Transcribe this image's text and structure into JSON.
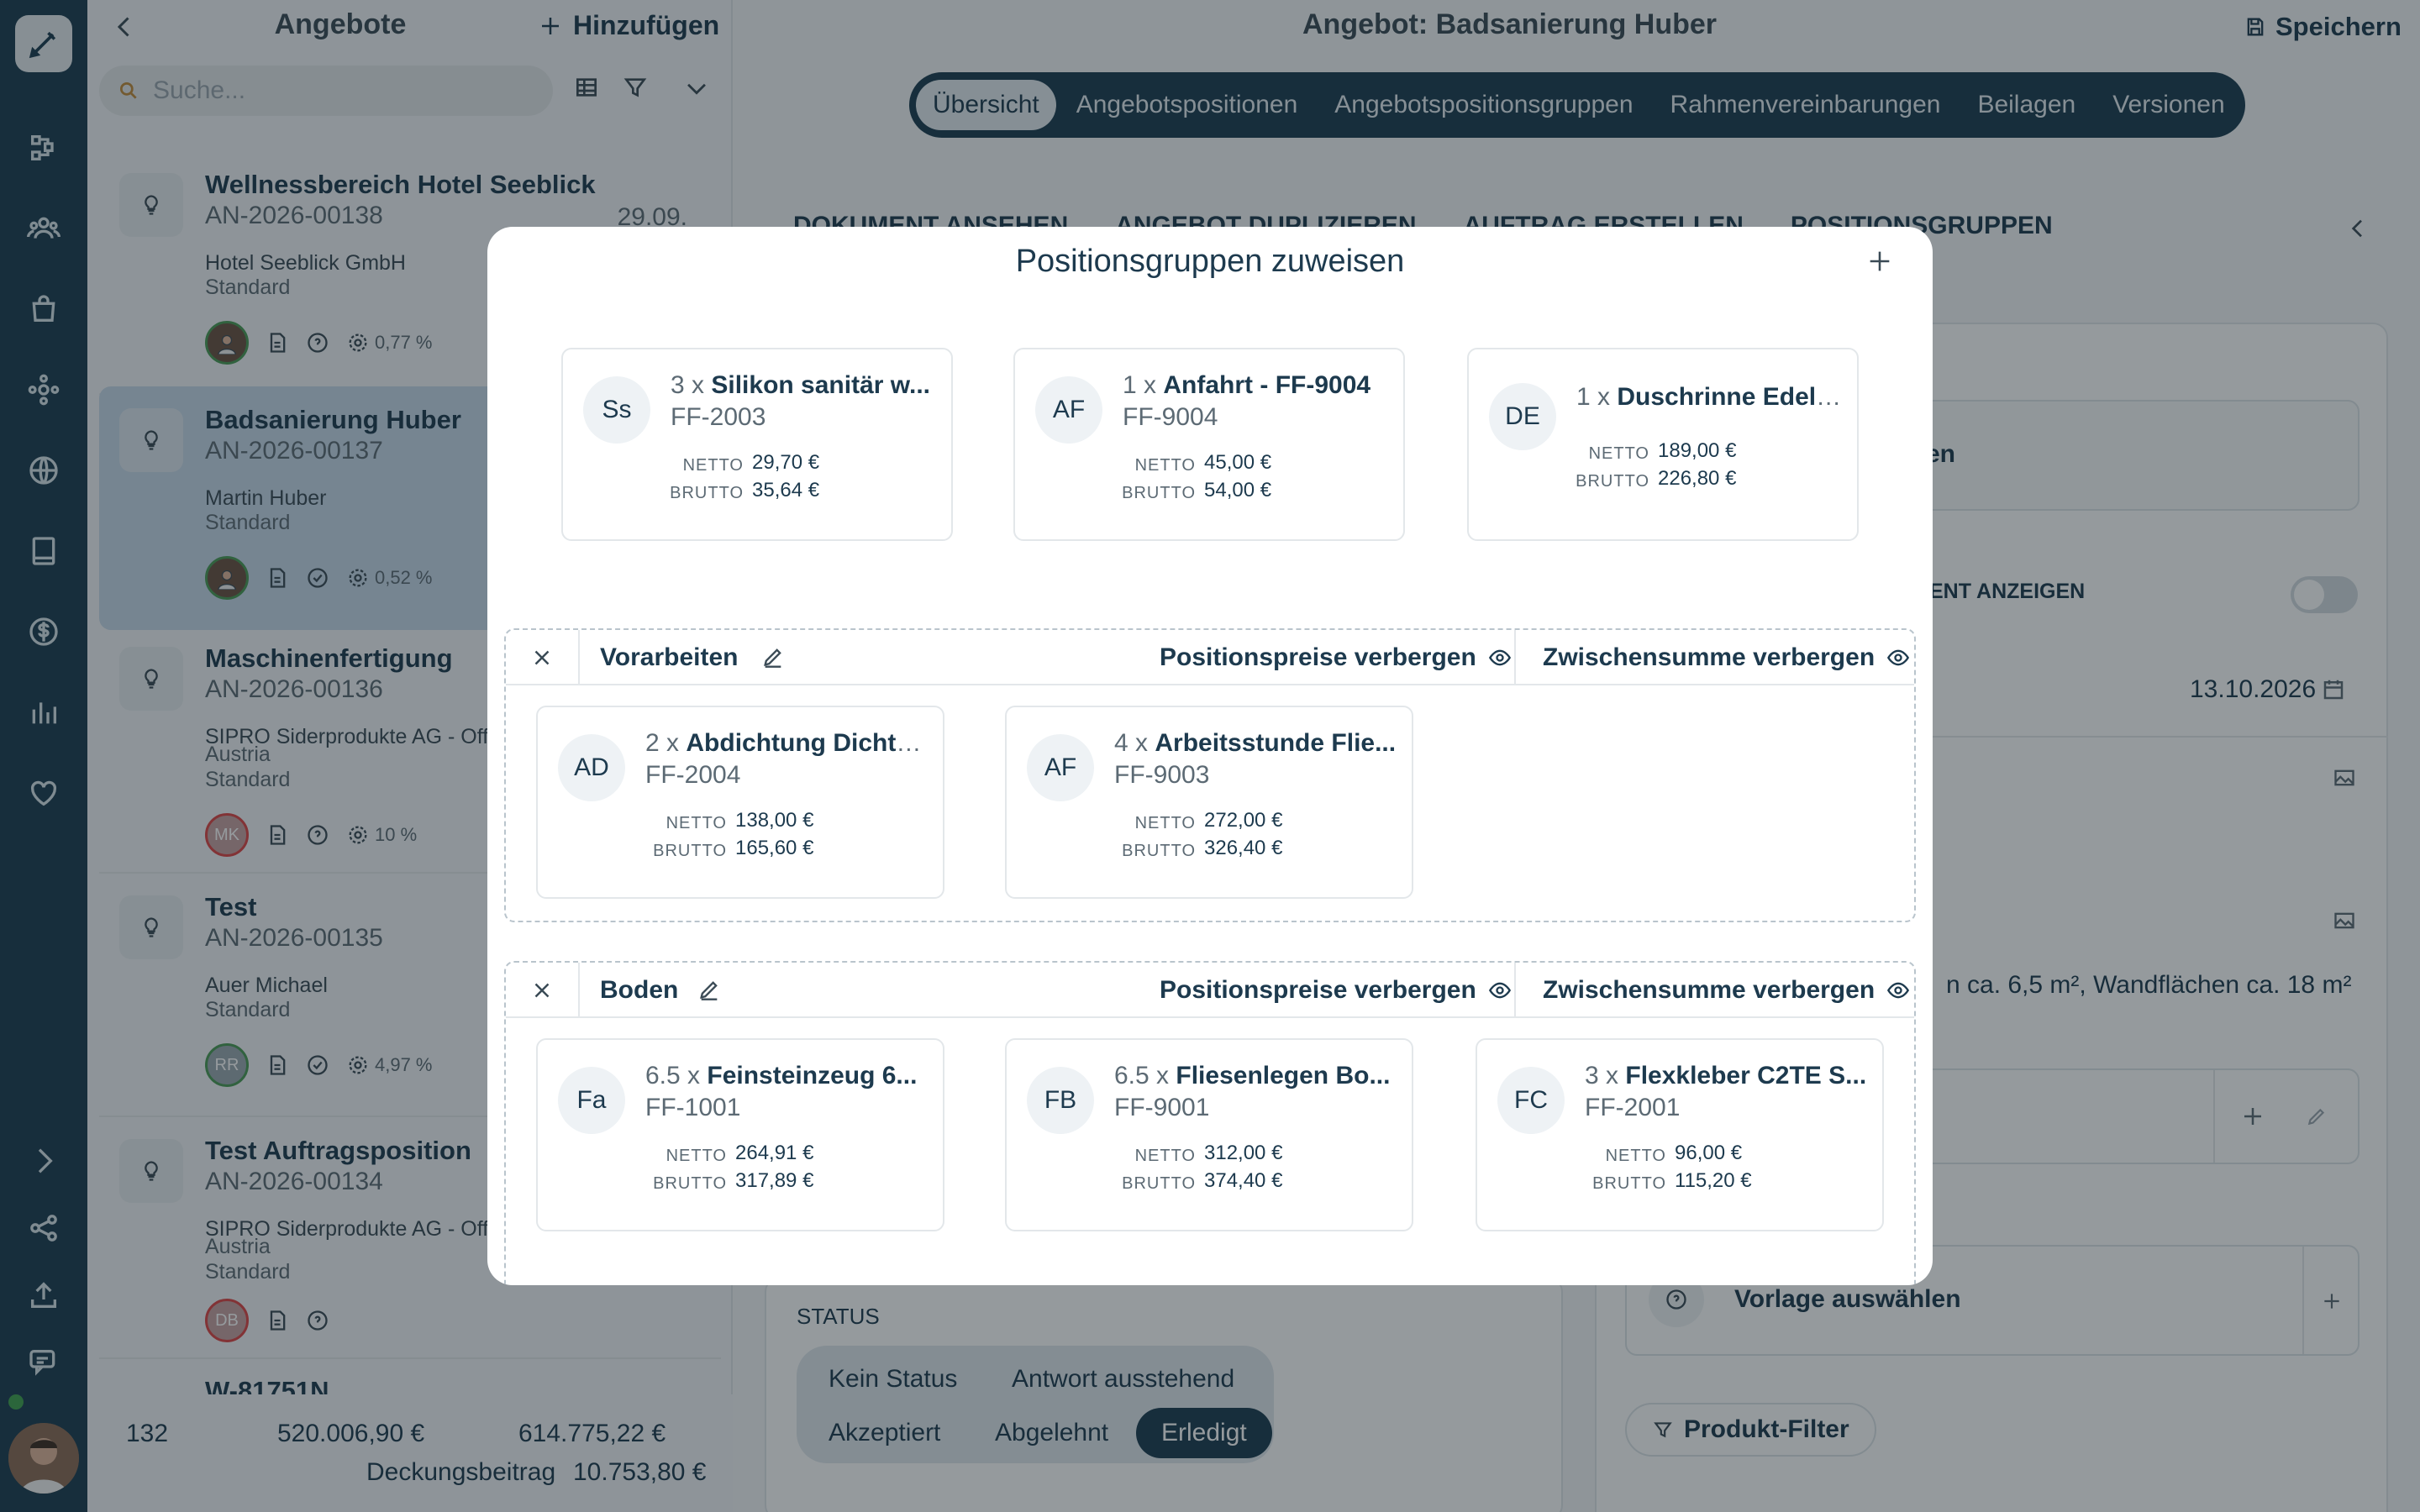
{
  "rail": {
    "icons": [
      "pencil-icon",
      "flow-icon",
      "people-icon",
      "bag-icon",
      "network-icon",
      "globe-icon",
      "book-icon",
      "dollar-icon",
      "bar-chart-icon",
      "heart-icon",
      "chevron-right-icon",
      "share-icon",
      "upload-icon",
      "chat-icon"
    ]
  },
  "list": {
    "title": "Angebote",
    "add_label": "Hinzufügen",
    "search_placeholder": "Suche...",
    "cards": [
      {
        "title": "Wellnessbereich Hotel Seeblick",
        "number": "AN-2026-00138",
        "date": "29.09.",
        "customer": "Hotel Seeblick GmbH",
        "type": "Standard",
        "percent": "0,77 %"
      },
      {
        "title": "Badsanierung Huber",
        "number": "AN-2026-00137",
        "customer": "Martin Huber",
        "type": "Standard",
        "percent": "0,52 %"
      },
      {
        "title": "Maschinenfertigung",
        "number": "AN-2026-00136",
        "customer": "SIPRO Siderprodukte AG - Off",
        "customer2": "Austria",
        "type": "Standard",
        "initials": "MK",
        "percent": "10 %"
      },
      {
        "title": "Test",
        "number": "AN-2026-00135",
        "customer": "Auer Michael",
        "type": "Standard",
        "initials": "RR",
        "percent": "4,97 %"
      },
      {
        "title": "Test Auftragsposition",
        "number": "AN-2026-00134",
        "customer": "SIPRO Siderprodukte AG - Off",
        "customer2": "Austria",
        "type": "Standard",
        "initials": "DB"
      },
      {
        "title": "W-81751N"
      }
    ],
    "footer": {
      "count": "132",
      "netto": "520.006,90 €",
      "brutto": "614.775,22 €",
      "db_label": "Deckungsbeitrag",
      "db_value": "10.753,80 €"
    }
  },
  "main": {
    "title": "Angebot: Badsanierung Huber",
    "save_label": "Speichern",
    "tabs": [
      "Übersicht",
      "Angebotspositionen",
      "Angebotspositionsgruppen",
      "Rahmenvereinbarungen",
      "Beilagen",
      "Versionen"
    ],
    "actions": [
      "DOKUMENT ANSEHEN",
      "ANGEBOT DUPLIZIEREN",
      "AUFTRAG ERSTELLEN",
      "POSITIONSGRUPPEN"
    ],
    "right": {
      "partial_button": "en",
      "show_doc_label": "ENT ANZEIGEN",
      "date": "13.10.2026",
      "description": "n ca. 6,5 m², Wandflächen ca. 18 m²",
      "template_label": "Vorlage auswählen",
      "filter_label": "Produkt-Filter"
    },
    "status": {
      "label": "STATUS",
      "options": [
        "Kein Status",
        "Antwort ausstehend",
        "Akzeptiert",
        "Abgelehnt",
        "Erledigt"
      ],
      "selected": "Erledigt"
    }
  },
  "modal": {
    "title": "Positionsgruppen zuweisen",
    "price_netto_label": "NETTO",
    "price_brutto_label": "BRUTTO",
    "unassigned": [
      {
        "abbr": "Ss",
        "qty": "3 x",
        "name": "Silikon sanitär w...",
        "code": "FF-2003",
        "netto": "29,70 €",
        "brutto": "35,64 €"
      },
      {
        "abbr": "AF",
        "qty": "1 x",
        "name": "Anfahrt - FF-9004",
        "code": "FF-9004",
        "netto": "45,00 €",
        "brutto": "54,00 €"
      },
      {
        "abbr": "DE",
        "qty": "1 x",
        "name": "Duschrinne Edels...",
        "code": "",
        "netto": "189,00 €",
        "brutto": "226,80 €"
      }
    ],
    "groups": [
      {
        "name": "Vorarbeiten",
        "hide_prices_label": "Positionspreise verbergen",
        "hide_subtotal_label": "Zwischensumme verbergen",
        "items": [
          {
            "abbr": "AD",
            "qty": "2 x",
            "name": "Abdichtung Dichts...",
            "code": "FF-2004",
            "netto": "138,00 €",
            "brutto": "165,60 €"
          },
          {
            "abbr": "AF",
            "qty": "4 x",
            "name": "Arbeitsstunde Flie...",
            "code": "FF-9003",
            "netto": "272,00 €",
            "brutto": "326,40 €"
          }
        ]
      },
      {
        "name": "Boden",
        "hide_prices_label": "Positionspreise verbergen",
        "hide_subtotal_label": "Zwischensumme verbergen",
        "items": [
          {
            "abbr": "Fa",
            "qty": "6.5 x",
            "name": "Feinsteinzeug 6...",
            "code": "FF-1001",
            "netto": "264,91 €",
            "brutto": "317,89 €"
          },
          {
            "abbr": "FB",
            "qty": "6.5 x",
            "name": "Fliesenlegen Bo...",
            "code": "FF-9001",
            "netto": "312,00 €",
            "brutto": "374,40 €"
          },
          {
            "abbr": "FC",
            "qty": "3 x",
            "name": "Flexkleber C2TE S...",
            "code": "FF-2001",
            "netto": "96,00 €",
            "brutto": "115,20 €"
          }
        ]
      }
    ]
  }
}
